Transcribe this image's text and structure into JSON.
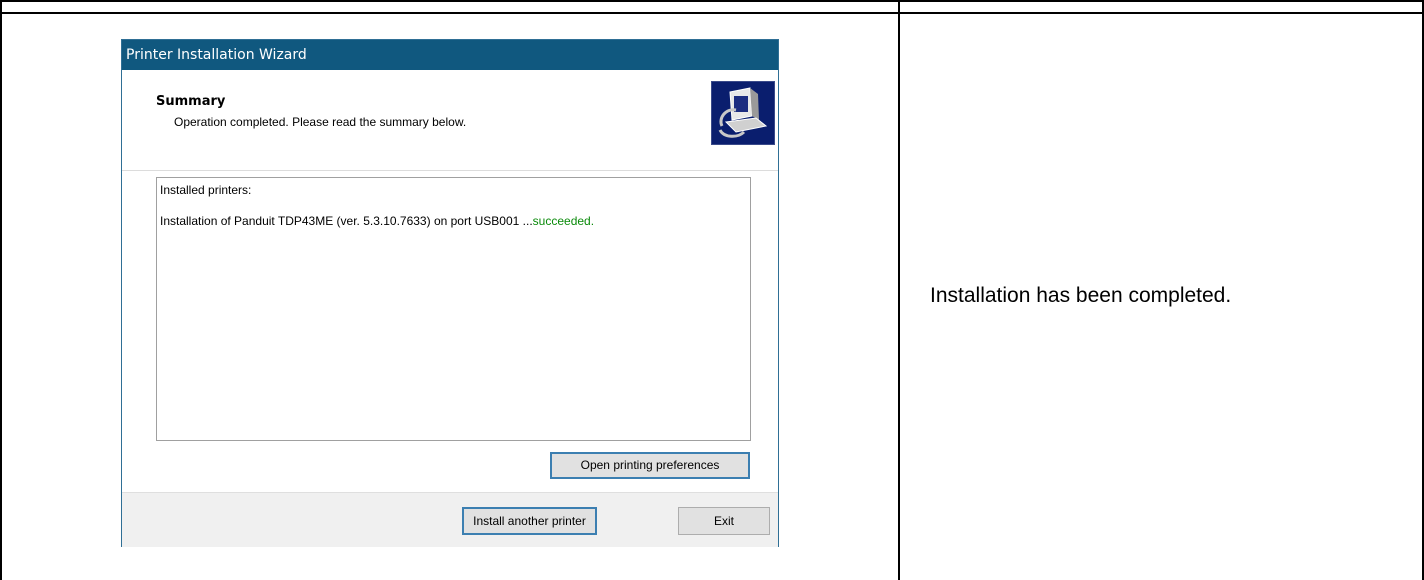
{
  "window": {
    "title": "Printer Installation Wizard"
  },
  "header": {
    "title": "Summary",
    "subtitle": "Operation completed. Please read the summary below.",
    "icon": "printer-setup-icon"
  },
  "summary": {
    "heading": "Installed printers:",
    "line_prefix": "Installation of Panduit TDP43ME (ver. 5.3.10.7633) on port USB001 ...",
    "line_status": "succeeded.",
    "status_color": "#0a8a0a"
  },
  "buttons": {
    "open_prefs": "Open printing preferences",
    "install_another": "Install another printer",
    "exit": "Exit"
  },
  "document": {
    "right_text": "Installation has been completed."
  },
  "colors": {
    "titlebar": "#10587f",
    "icon_bg": "#0a1e6e"
  }
}
